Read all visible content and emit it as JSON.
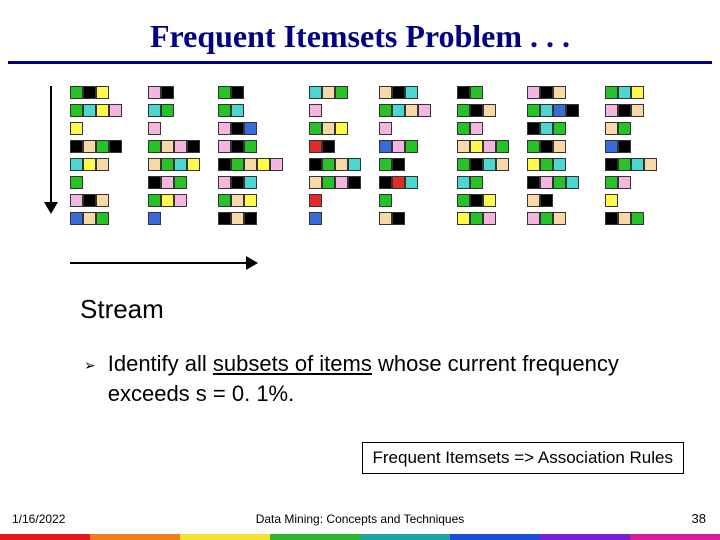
{
  "title": "Frequent Itemsets Problem . . .",
  "stream_label": "Stream",
  "bullet_marker": "➢",
  "bullet_pre": "Identify all ",
  "bullet_under": "subsets of items",
  "bullet_post": " whose current frequency exceeds  s = 0. 1%.",
  "box_text": "Frequent Itemsets => Association Rules",
  "footer_date": "1/16/2022",
  "footer_center": "Data Mining: Concepts and Techniques",
  "footer_page": "38",
  "colors": {
    "title": "#000080",
    "rule": "#000080",
    "rainbow": [
      "#e11b1b",
      "#f07e1e",
      "#f5e236",
      "#2fb52f",
      "#1fa3a3",
      "#1b4fd1",
      "#7a1fd1",
      "#d11f9e"
    ]
  },
  "itemsets": {
    "groups": [
      {
        "columns": [
          [
            [
              "G",
              "K",
              "Y"
            ],
            [
              "G",
              "C",
              "Y",
              "P"
            ],
            [
              "Y"
            ],
            [
              "K",
              "S",
              "G",
              "K"
            ],
            [
              "C",
              "Y",
              "S"
            ],
            [
              "G"
            ],
            [
              "P",
              "K",
              "S"
            ],
            [
              "B",
              "S",
              "G"
            ]
          ],
          [
            [
              "P",
              "K"
            ],
            [
              "C",
              "G"
            ],
            [
              "P"
            ],
            [
              "G",
              "S",
              "P",
              "K"
            ],
            [
              "S",
              "G",
              "C",
              "Y"
            ],
            [
              "K",
              "P",
              "G"
            ],
            [
              "G",
              "Y",
              "P"
            ],
            [
              "B"
            ]
          ]
        ]
      },
      {
        "columns": [
          [
            [
              "G",
              "K"
            ],
            [
              "G",
              "C"
            ],
            [
              "P",
              "K",
              "B"
            ],
            [
              "P",
              "K",
              "G"
            ],
            [
              "K",
              "G",
              "S",
              "Y",
              "P"
            ],
            [
              "P",
              "K",
              "C"
            ],
            [
              "G",
              "S",
              "Y"
            ],
            [
              "K",
              "S",
              "K"
            ]
          ],
          [
            [
              "C",
              "S",
              "G"
            ],
            [
              "P"
            ],
            [
              "G",
              "S",
              "Y"
            ],
            [
              "R",
              "K"
            ],
            [
              "K",
              "G",
              "S",
              "C"
            ],
            [
              "S",
              "G",
              "P",
              "K"
            ],
            [
              "R"
            ],
            [
              "B"
            ]
          ]
        ]
      },
      {
        "columns": [
          [
            [
              "S",
              "K",
              "C"
            ],
            [
              "G",
              "C",
              "S",
              "P"
            ],
            [
              "P"
            ],
            [
              "B",
              "P",
              "G"
            ],
            [
              "G",
              "K"
            ],
            [
              "K",
              "R",
              "C"
            ],
            [
              "G"
            ],
            [
              "S",
              "K"
            ]
          ],
          [
            [
              "K",
              "G"
            ],
            [
              "G",
              "K",
              "S"
            ],
            [
              "G",
              "P"
            ],
            [
              "S",
              "Y",
              "P",
              "G"
            ],
            [
              "G",
              "K",
              "C",
              "S"
            ],
            [
              "C",
              "G"
            ],
            [
              "G",
              "K",
              "Y"
            ],
            [
              "Y",
              "G",
              "P"
            ]
          ]
        ]
      },
      {
        "columns": [
          [
            [
              "P",
              "K",
              "S"
            ],
            [
              "G",
              "C",
              "B",
              "K"
            ],
            [
              "K",
              "C",
              "G"
            ],
            [
              "G",
              "K",
              "S"
            ],
            [
              "Y",
              "G",
              "C"
            ],
            [
              "K",
              "P",
              "G",
              "C"
            ],
            [
              "S",
              "K"
            ],
            [
              "P",
              "G",
              "S"
            ]
          ],
          [
            [
              "G",
              "C",
              "Y"
            ],
            [
              "P",
              "K",
              "S"
            ],
            [
              "S",
              "G"
            ],
            [
              "B",
              "K"
            ],
            [
              "K",
              "G",
              "C",
              "S"
            ],
            [
              "G",
              "P"
            ],
            [
              "Y"
            ],
            [
              "K",
              "S",
              "G"
            ]
          ]
        ]
      }
    ]
  }
}
